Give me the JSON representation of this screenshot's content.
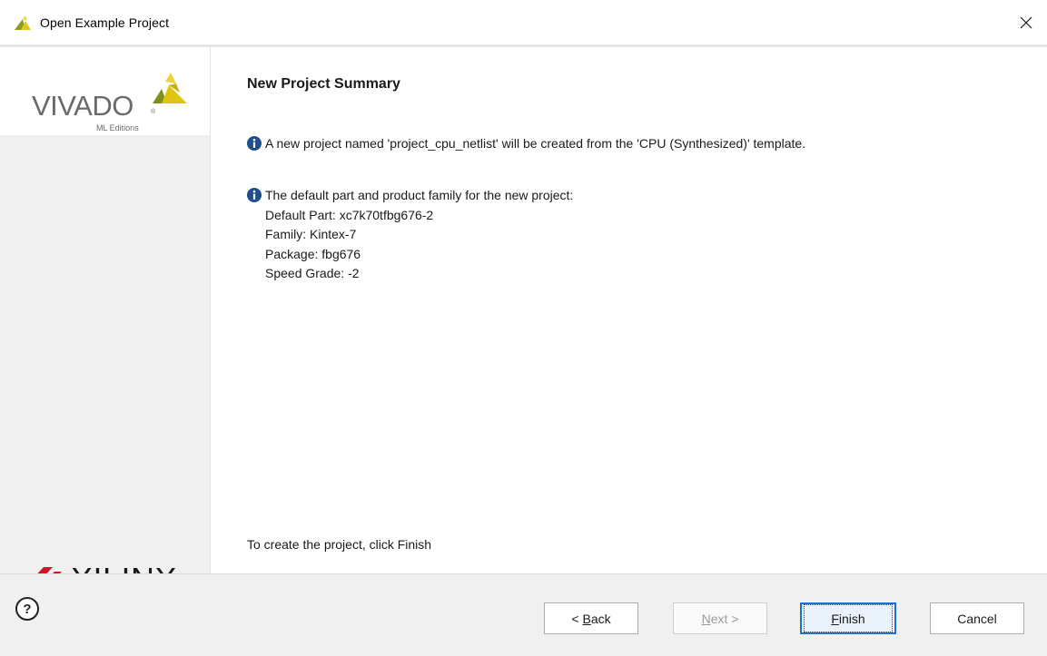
{
  "window": {
    "title": "Open Example Project"
  },
  "branding": {
    "vivado_word": "VIVADO",
    "vivado_reg": "®",
    "ml_editions": "ML Editions",
    "xilinx_word": "XILINX",
    "xilinx_reg": "®"
  },
  "page": {
    "heading": "New Project Summary",
    "info1": "A new project named 'project_cpu_netlist' will be created from the 'CPU (Synthesized)' template.",
    "info2_lead": "The default part and product family for the new project:",
    "details": {
      "default_part": "Default Part: xc7k70tfbg676-2",
      "family": "Family: Kintex-7",
      "package": "Package: fbg676",
      "speed_grade": "Speed Grade: -2"
    },
    "footer_note": "To create the project, click Finish"
  },
  "buttons": {
    "help": "?",
    "back_prefix": "< ",
    "back_mnemonic": "B",
    "back_rest": "ack",
    "next_mnemonic": "N",
    "next_rest": "ext >",
    "finish_mnemonic": "F",
    "finish_rest": "inish",
    "cancel": "Cancel"
  },
  "icons": {
    "app": "vivado-app-icon",
    "close": "close-icon",
    "info": "info-icon",
    "help": "help-icon"
  },
  "colors": {
    "accent": "#1f6fd1",
    "info_icon": "#1e4e8c",
    "vivado_yellow": "#c8b400",
    "vivado_olive": "#6b7a1a",
    "xilinx_red": "#d3122a"
  }
}
